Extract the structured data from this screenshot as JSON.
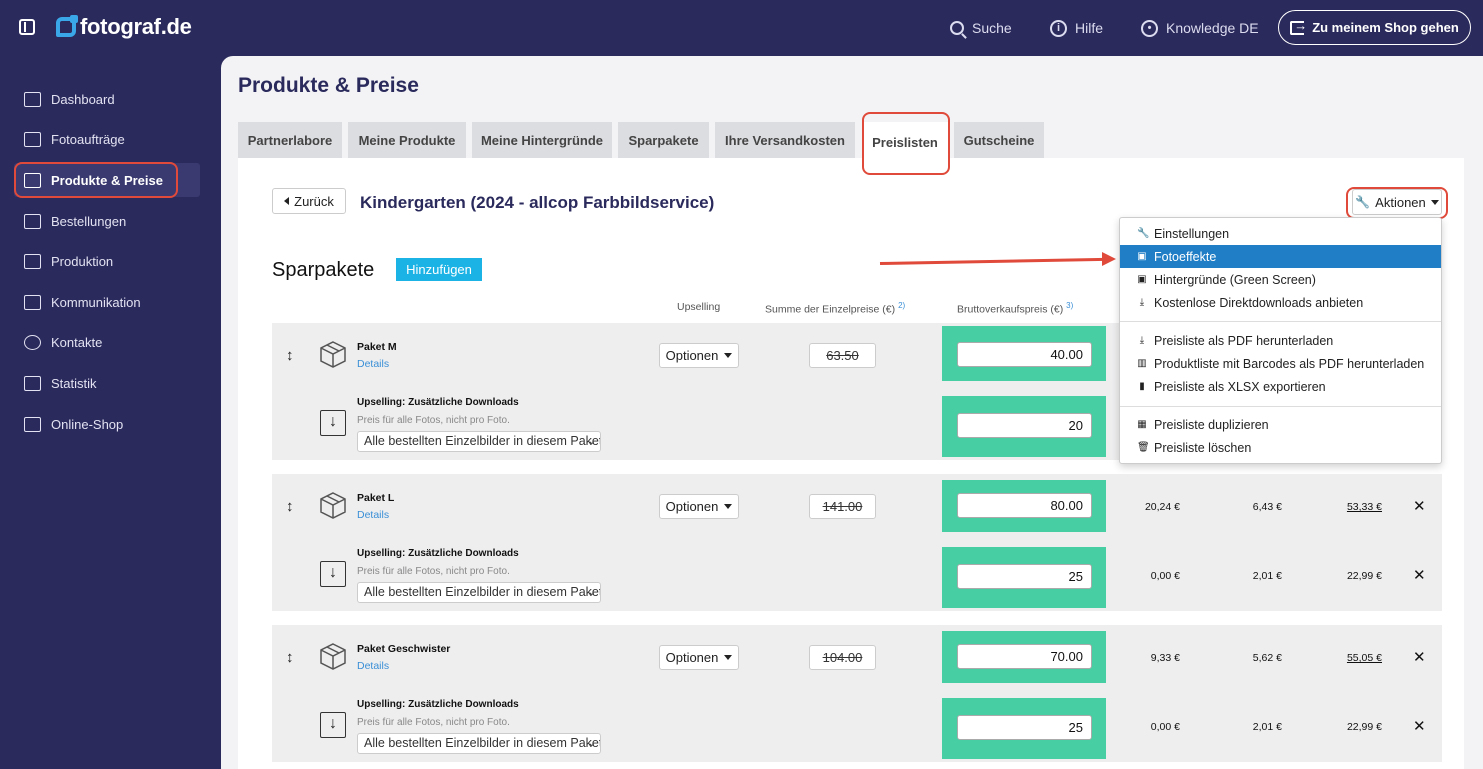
{
  "app": {
    "logo": "fotograf.de"
  },
  "topnav": {
    "search": "Suche",
    "help": "Hilfe",
    "knowledge": "Knowledge DE",
    "shop_button": "Zu meinem Shop gehen"
  },
  "sidebar": {
    "items": [
      {
        "label": "Dashboard",
        "icon": "home-icon"
      },
      {
        "label": "Fotoaufträge",
        "icon": "image-icon"
      },
      {
        "label": "Produkte & Preise",
        "icon": "cart-icon",
        "active": true
      },
      {
        "label": "Bestellungen",
        "icon": "box-icon"
      },
      {
        "label": "Produktion",
        "icon": "printer-icon"
      },
      {
        "label": "Kommunikation",
        "icon": "chat-icon"
      },
      {
        "label": "Kontakte",
        "icon": "user-icon"
      },
      {
        "label": "Statistik",
        "icon": "chart-icon"
      },
      {
        "label": "Online-Shop",
        "icon": "store-icon"
      }
    ]
  },
  "page": {
    "title": "Produkte & Preise"
  },
  "tabs": [
    "Partnerlabore",
    "Meine Produkte",
    "Meine Hintergründe",
    "Sparpakete",
    "Ihre Versandkosten",
    "Preislisten",
    "Gutscheine"
  ],
  "active_tab": "Preislisten",
  "panel": {
    "back": "Zurück",
    "title": "Kindergarten (2024 - allcop Farbbildservice)",
    "actions": "Aktionen"
  },
  "section": {
    "title": "Sparpakete",
    "add": "Hinzufügen"
  },
  "columns": {
    "upselling": "Upselling",
    "sum": "Summe der Einzelpreise (€)",
    "sum_sup": "2)",
    "gross": "Bruttoverkaufspreis (€)",
    "gross_sup": "3)"
  },
  "packages": [
    {
      "name": "Paket M",
      "details": "Details",
      "options": "Optionen",
      "sum": "63.50",
      "price": "40.00",
      "c1": "",
      "c2": "",
      "c3": "",
      "ups_title": "Upselling: Zusätzliche Downloads",
      "ups_sub": "Preis für alle Fotos, nicht pro Foto.",
      "ups_select": "Alle bestellten Einzelbilder in diesem Paket",
      "ups_price": "20",
      "u1": "",
      "u2": "",
      "u3": ""
    },
    {
      "name": "Paket L",
      "details": "Details",
      "options": "Optionen",
      "sum": "141.00",
      "price": "80.00",
      "c1": "20,24 €",
      "c2": "6,43 €",
      "c3": "53,33 €",
      "ups_title": "Upselling: Zusätzliche Downloads",
      "ups_sub": "Preis für alle Fotos, nicht pro Foto.",
      "ups_select": "Alle bestellten Einzelbilder in diesem Paket",
      "ups_price": "25",
      "u1": "0,00 €",
      "u2": "2,01 €",
      "u3": "22,99 €"
    },
    {
      "name": "Paket Geschwister",
      "details": "Details",
      "options": "Optionen",
      "sum": "104.00",
      "price": "70.00",
      "c1": "9,33 €",
      "c2": "5,62 €",
      "c3": "55,05 €",
      "ups_title": "Upselling: Zusätzliche Downloads",
      "ups_sub": "Preis für alle Fotos, nicht pro Foto.",
      "ups_select": "Alle bestellten Einzelbilder in diesem Paket",
      "ups_price": "25",
      "u1": "0,00 €",
      "u2": "2,01 €",
      "u3": "22,99 €"
    }
  ],
  "dropdown": [
    {
      "label": "Einstellungen",
      "icon": "wrench-icon"
    },
    {
      "label": "Fotoeffekte",
      "icon": "image-icon",
      "active": true
    },
    {
      "label": "Hintergründe (Green Screen)",
      "icon": "image-icon"
    },
    {
      "label": "Kostenlose Direktdownloads anbieten",
      "icon": "download-icon"
    },
    {
      "label": "Preisliste als PDF herunterladen",
      "icon": "download-icon"
    },
    {
      "label": "Produktliste mit Barcodes als PDF herunterladen",
      "icon": "barcode-icon"
    },
    {
      "label": "Preisliste als XLSX exportieren",
      "icon": "file-icon"
    },
    {
      "label": "Preisliste duplizieren",
      "icon": "table-icon"
    },
    {
      "label": "Preisliste löschen",
      "icon": "trash-icon"
    }
  ],
  "colors": {
    "sidebar": "#2b2a5c",
    "accent": "#1bb3e6",
    "price_cell": "#47cfa3",
    "highlight": "#e04a3a",
    "menu_active": "#1f7ec6"
  }
}
